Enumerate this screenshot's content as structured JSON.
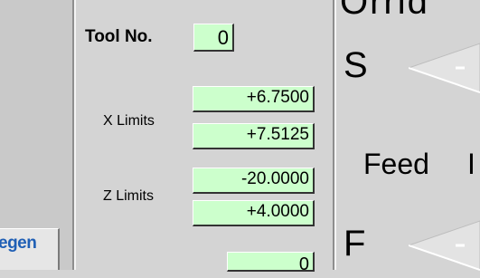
{
  "left_panel": {
    "button_label": "egen"
  },
  "tool": {
    "label": "Tool No.",
    "value": "0"
  },
  "x_limits": {
    "label": "X Limits",
    "min": "+6.7500",
    "max": "+7.5125"
  },
  "z_limits": {
    "label": "Z Limits",
    "min": "-20.0000",
    "max": "+4.0000"
  },
  "bottom_field": {
    "value": "0"
  },
  "right_panel": {
    "top_text": "Orrid",
    "s_label": "S",
    "feed_label": "Feed",
    "feed_edge": "I",
    "f_label": "F"
  },
  "icons": {
    "speed_slider": "slider-arrow-icon",
    "feed_slider": "slider-arrow-icon"
  },
  "colors": {
    "field_bg": "#ccffcc",
    "panel_bg": "#d4d4d4",
    "link_blue": "#1f5fb5"
  }
}
